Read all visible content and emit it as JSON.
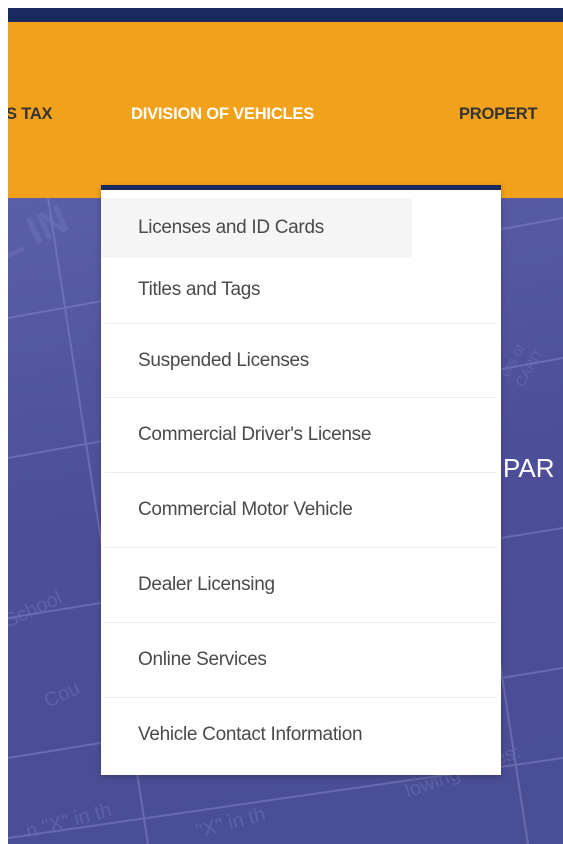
{
  "nav": {
    "left_label": "S TAX",
    "active_label": "DIVISION OF VEHICLES",
    "right_label": "PROPERT"
  },
  "hero": {
    "partial_text": "PAR"
  },
  "dropdown": {
    "items": [
      {
        "label": "Licenses and ID Cards"
      },
      {
        "label": "Titles and Tags"
      },
      {
        "label": "Suspended Licenses"
      },
      {
        "label": "Commercial Driver's License"
      },
      {
        "label": "Commercial Motor Vehicle"
      },
      {
        "label": "Dealer Licensing"
      },
      {
        "label": "Online Services"
      },
      {
        "label": "Vehicle Contact Information"
      }
    ]
  },
  "colors": {
    "nav_background": "#f2a21a",
    "topbar": "#1b2a5e",
    "hero_overlay": "#4c4f97"
  }
}
